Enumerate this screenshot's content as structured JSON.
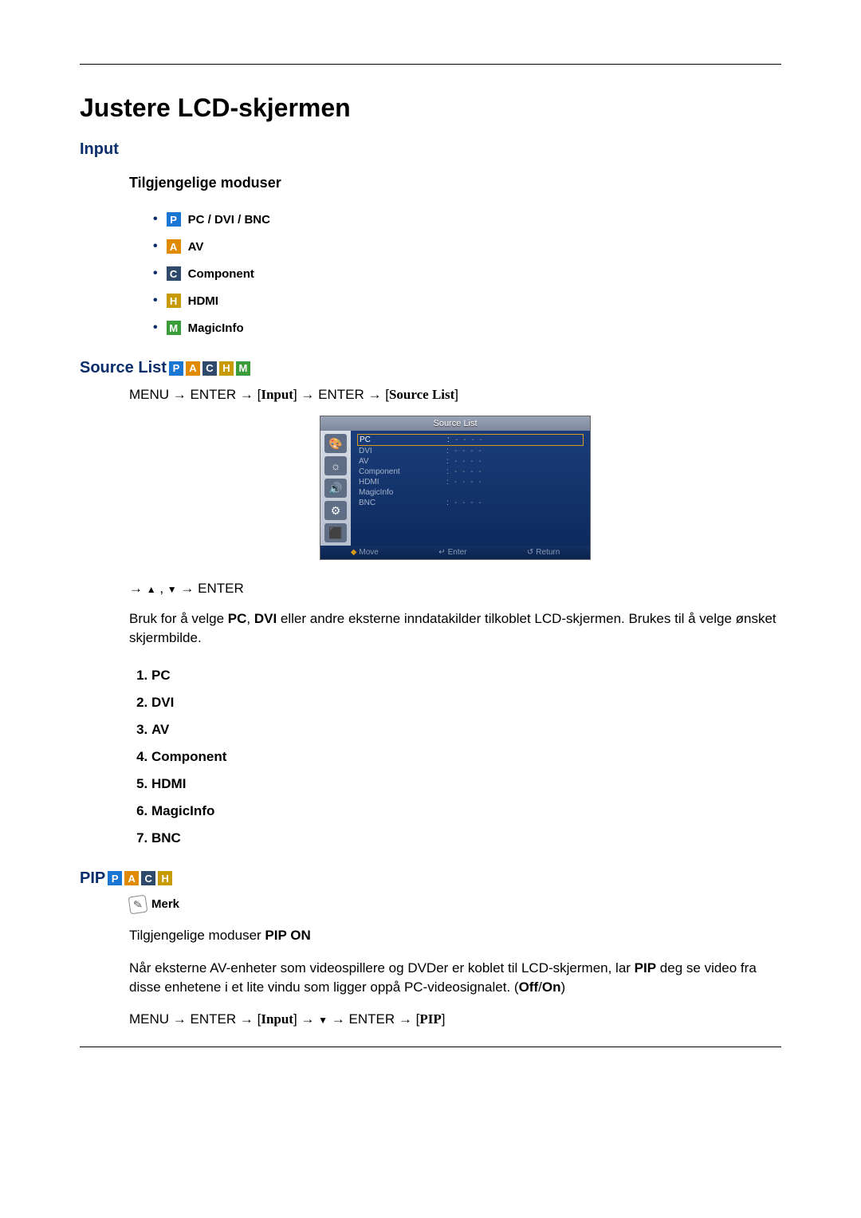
{
  "page_title": "Justere LCD-skjermen",
  "sections": {
    "input": {
      "title": "Input"
    },
    "modes": {
      "title": "Tilgjengelige moduser",
      "items": {
        "pc": "PC / DVI / BNC",
        "av": "AV",
        "component": "Component",
        "hdmi": "HDMI",
        "magicinfo": "MagicInfo"
      }
    },
    "source_list": {
      "title": "Source List",
      "menu_path": {
        "menu": "MENU",
        "enter": "ENTER",
        "input_kw": "Input",
        "source_kw": "Source List"
      },
      "nav": {
        "enter": "ENTER"
      },
      "osd": {
        "title": "Source List",
        "rows": {
          "pc": {
            "label": "PC",
            "value": "- - - -"
          },
          "dvi": {
            "label": "DVI",
            "value": "- - - -"
          },
          "av": {
            "label": "AV",
            "value": "- - - -"
          },
          "component": {
            "label": "Component",
            "value": "- - - -"
          },
          "hdmi": {
            "label": "HDMI",
            "value": "- - - -"
          },
          "magicinfo": {
            "label": "MagicInfo",
            "value": ""
          },
          "bnc": {
            "label": "BNC",
            "value": "- - - -"
          }
        },
        "bottom": {
          "move": "Move",
          "enter": "Enter",
          "return": "Return"
        }
      },
      "body_pre": "Bruk for å velge ",
      "body_pc": "PC",
      "body_mid1": ", ",
      "body_dvi": "DVI",
      "body_post": " eller andre eksterne inndatakilder tilkoblet LCD-skjermen. Brukes til å velge ønsket skjermbilde.",
      "list": {
        "i1": "PC",
        "i2": "DVI",
        "i3": "AV",
        "i4": "Component",
        "i5": "HDMI",
        "i6": "MagicInfo",
        "i7": "BNC"
      }
    },
    "pip": {
      "title": "PIP",
      "note_label": "Merk",
      "modes_text_pre": "Tilgjengelige moduser ",
      "modes_text_bold": "PIP ON",
      "desc_pre": "Når eksterne AV-enheter som videospillere og DVDer er koblet til LCD-skjermen, lar ",
      "desc_b1": "PIP",
      "desc_mid": " deg se video fra disse enhetene i et lite vindu som ligger oppå PC-videosignalet. (",
      "desc_b2": "Off",
      "desc_slash": "/",
      "desc_b3": "On",
      "desc_end": ")",
      "menu_path": {
        "menu": "MENU",
        "enter": "ENTER",
        "input_kw": "Input",
        "pip_kw": "PIP"
      }
    }
  }
}
